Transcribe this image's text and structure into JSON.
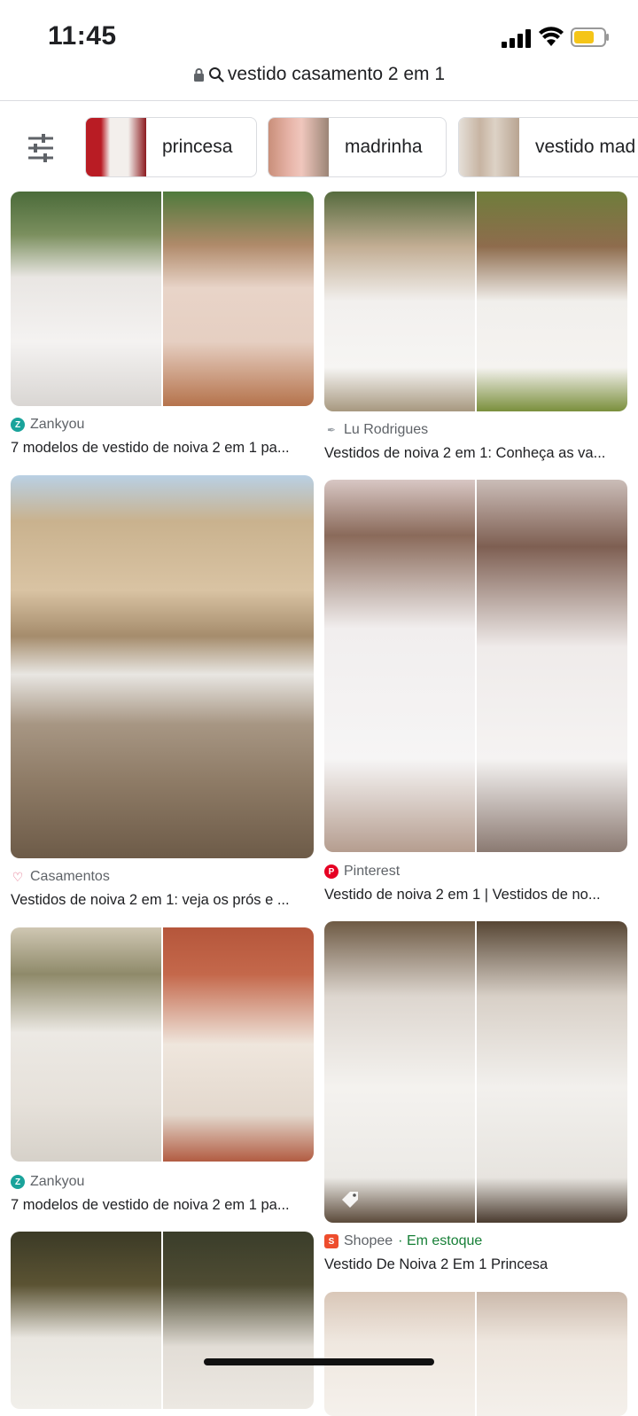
{
  "status": {
    "time": "11:45"
  },
  "url": {
    "query": "vestido casamento 2 em 1"
  },
  "chips": [
    {
      "label": "princesa"
    },
    {
      "label": "madrinha"
    },
    {
      "label": "vestido mad"
    }
  ],
  "results": [
    {
      "source": "Zankyou",
      "title": "7 modelos de vestido de noiva 2 em 1 pa..."
    },
    {
      "source": "Lu Rodrigues",
      "title": "Vestidos de noiva 2 em 1: Conheça as va..."
    },
    {
      "source": "Casamentos",
      "title": "Vestidos de noiva 2 em 1: veja os prós e ..."
    },
    {
      "source": "Pinterest",
      "title": "Vestido de noiva 2 em 1 | Vestidos de no..."
    },
    {
      "source": "Zankyou",
      "title": "7 modelos de vestido de noiva 2 em 1 pa..."
    },
    {
      "source": "Shopee",
      "stock": " · Em estoque",
      "title": "Vestido De Noiva 2 Em 1 Princesa"
    }
  ],
  "colors": {
    "battery": "#f5c518",
    "zankyou": "#1aa39b",
    "pinterest": "#e60023",
    "shopee": "#ee4d2d",
    "stock": "#188038"
  },
  "icons": [
    "lock-icon",
    "search-icon",
    "filter-icon",
    "shopping-tag-icon"
  ]
}
